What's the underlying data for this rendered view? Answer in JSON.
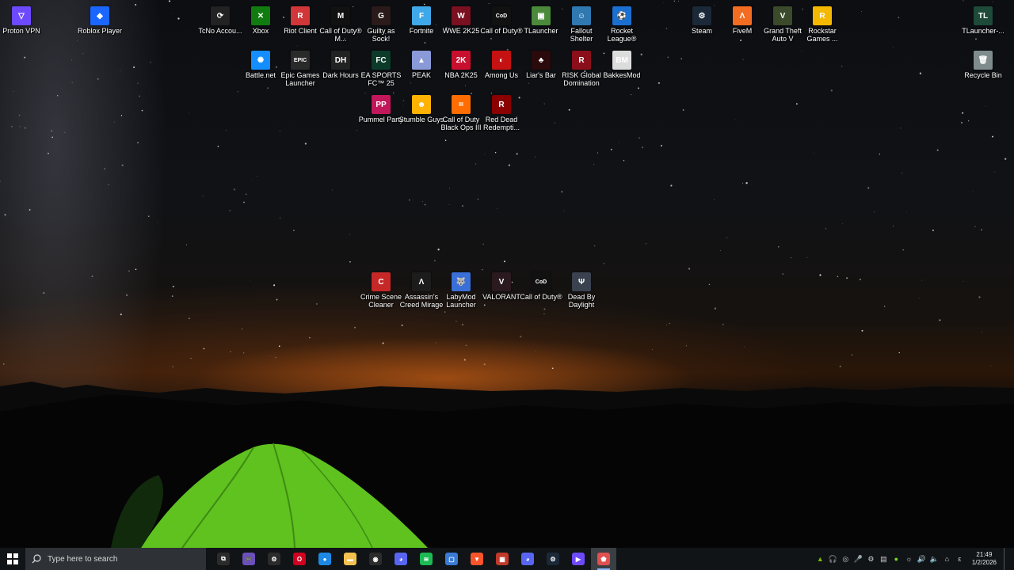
{
  "desktop": {
    "icons": [
      {
        "label": "Proton VPN",
        "icon": "proton-vpn-icon",
        "color": "#6d4aff",
        "glyph": "▽"
      },
      {
        "label": "Roblox Player",
        "icon": "roblox-icon",
        "color": "#1a66ff",
        "glyph": "◆"
      },
      {
        "label": "TcNo Accou...",
        "icon": "tcno-icon",
        "color": "#222222",
        "glyph": "⟳"
      },
      {
        "label": "Xbox",
        "icon": "xbox-icon",
        "color": "#107c10",
        "glyph": "✕"
      },
      {
        "label": "Riot Client",
        "icon": "riot-client-icon",
        "color": "#d13639",
        "glyph": "R"
      },
      {
        "label": "Call of Duty® M...",
        "icon": "cod-mobile-icon",
        "color": "#111111",
        "glyph": "M"
      },
      {
        "label": "Guilty as Sock!",
        "icon": "guilty-as-sock-icon",
        "color": "#2a1a1a",
        "glyph": "G"
      },
      {
        "label": "Fortnite",
        "icon": "fortnite-icon",
        "color": "#3fa8e8",
        "glyph": "F"
      },
      {
        "label": "WWE 2K25",
        "icon": "wwe-icon",
        "color": "#7a1020",
        "glyph": "W"
      },
      {
        "label": "Call of Duty®",
        "icon": "cod-icon",
        "color": "#111111",
        "glyph": "CoD"
      },
      {
        "label": "TLauncher",
        "icon": "tlauncher-icon",
        "color": "#4a8a3a",
        "glyph": "▣"
      },
      {
        "label": "Fallout Shelter",
        "icon": "fallout-shelter-icon",
        "color": "#2f78b0",
        "glyph": "☺"
      },
      {
        "label": "Rocket League®",
        "icon": "rocket-league-icon",
        "color": "#1b6fd1",
        "glyph": "⚽"
      },
      {
        "label": "Steam",
        "icon": "steam-icon",
        "color": "#1b2838",
        "glyph": "⚙"
      },
      {
        "label": "FiveM",
        "icon": "fivem-icon",
        "color": "#f26c22",
        "glyph": "Λ"
      },
      {
        "label": "Grand Theft Auto V",
        "icon": "gta-v-icon",
        "color": "#3b4a2a",
        "glyph": "V"
      },
      {
        "label": "Rockstar Games ...",
        "icon": "rockstar-icon",
        "color": "#f5b800",
        "glyph": "R"
      },
      {
        "label": "TLauncher-...",
        "icon": "tlauncher-legacy-icon",
        "color": "#1e4a3a",
        "glyph": "TL"
      },
      {
        "label": "Battle.net",
        "icon": "battlenet-icon",
        "color": "#148eff",
        "glyph": "✺"
      },
      {
        "label": "Epic Games Launcher",
        "icon": "epic-games-icon",
        "color": "#2a2a2a",
        "glyph": "EPIC"
      },
      {
        "label": "Dark Hours",
        "icon": "dark-hours-icon",
        "color": "#222222",
        "glyph": "DH"
      },
      {
        "label": "EA SPORTS FC™ 25",
        "icon": "ea-fc-icon",
        "color": "#0d3b2a",
        "glyph": "FC"
      },
      {
        "label": "PEAK",
        "icon": "peak-icon",
        "color": "#8a9ad8",
        "glyph": "▲"
      },
      {
        "label": "NBA 2K25",
        "icon": "nba-icon",
        "color": "#c8102e",
        "glyph": "2K"
      },
      {
        "label": "Among Us",
        "icon": "among-us-icon",
        "color": "#c51111",
        "glyph": "◐"
      },
      {
        "label": "Liar's Bar",
        "icon": "liars-bar-icon",
        "color": "#2a0a0a",
        "glyph": "♣"
      },
      {
        "label": "RISK Global Domination",
        "icon": "risk-icon",
        "color": "#8a0f1a",
        "glyph": "R"
      },
      {
        "label": "BakkesMod",
        "icon": "bakkesmod-icon",
        "color": "#dcdcdc",
        "glyph": "BM"
      },
      {
        "label": "Recycle Bin",
        "icon": "recycle-bin-icon",
        "color": "#7f8c8d",
        "glyph": "🗑"
      },
      {
        "label": "Pummel Party",
        "icon": "pummel-party-icon",
        "color": "#c2185b",
        "glyph": "PP"
      },
      {
        "label": "Stumble Guys",
        "icon": "stumble-guys-icon",
        "color": "#ffb300",
        "glyph": "☻"
      },
      {
        "label": "Call of Duty Black Ops III",
        "icon": "black-ops-iii-icon",
        "color": "#ff6d00",
        "glyph": "III"
      },
      {
        "label": "Red Dead Redempti...",
        "icon": "red-dead-icon",
        "color": "#8b0000",
        "glyph": "R"
      },
      {
        "label": "Crime Scene Cleaner",
        "icon": "crime-scene-cleaner-icon",
        "color": "#c62828",
        "glyph": "C"
      },
      {
        "label": "Assassin's Creed Mirage",
        "icon": "ac-mirage-icon",
        "color": "#1c1c1c",
        "glyph": "Λ"
      },
      {
        "label": "LabyMod Launcher",
        "icon": "labymod-icon",
        "color": "#3b6fd8",
        "glyph": "🐺"
      },
      {
        "label": "VALORANT",
        "icon": "valorant-icon",
        "color": "#2a1a1f",
        "glyph": "V"
      },
      {
        "label": "Call of Duty®",
        "icon": "cod-icon-2",
        "color": "#111111",
        "glyph": "CoD"
      },
      {
        "label": "Dead By Daylight",
        "icon": "dead-by-daylight-icon",
        "color": "#3a4250",
        "glyph": "Ψ"
      }
    ]
  },
  "taskbar": {
    "start_icon": "windows-start-icon",
    "search_placeholder": "Type here to search",
    "apps": [
      {
        "name": "task-view",
        "color": "#2b2b2b",
        "glyph": "⧉"
      },
      {
        "name": "game-controller",
        "color": "#6b4fbb",
        "glyph": "🎮"
      },
      {
        "name": "steelseries",
        "color": "#2b2b2b",
        "glyph": "⚙"
      },
      {
        "name": "opera",
        "color": "#d00020",
        "glyph": "O"
      },
      {
        "name": "chrome",
        "color": "#1e88e5",
        "glyph": "●"
      },
      {
        "name": "file-explorer",
        "color": "#f2c14e",
        "glyph": "▬"
      },
      {
        "name": "obs",
        "color": "#2b2b2b",
        "glyph": "◉"
      },
      {
        "name": "discord-ptb",
        "color": "#5865f2",
        "glyph": "◕"
      },
      {
        "name": "spotify",
        "color": "#1db954",
        "glyph": "≋"
      },
      {
        "name": "store-window",
        "color": "#3a7bd5",
        "glyph": "▢"
      },
      {
        "name": "brave",
        "color": "#fb542b",
        "glyph": "▼"
      },
      {
        "name": "pixel-app",
        "color": "#c0392b",
        "glyph": "▦"
      },
      {
        "name": "discord",
        "color": "#5865f2",
        "glyph": "◕"
      },
      {
        "name": "steam",
        "color": "#1b2838",
        "glyph": "⚙"
      },
      {
        "name": "proton-vpn",
        "color": "#6d4aff",
        "glyph": "▶"
      },
      {
        "name": "app-active",
        "color": "#e05050",
        "glyph": "⬟"
      }
    ],
    "tray_icons": [
      "nvidia-icon",
      "headset-icon",
      "gamebar-icon",
      "microphone-icon",
      "steam-tray-icon",
      "network-icon",
      "green-status-icon",
      "brightness-icon",
      "volume-icon",
      "speaker-icon",
      "wifi-icon",
      "language-icon"
    ],
    "time": "21:49",
    "date": "1/2/2026"
  }
}
